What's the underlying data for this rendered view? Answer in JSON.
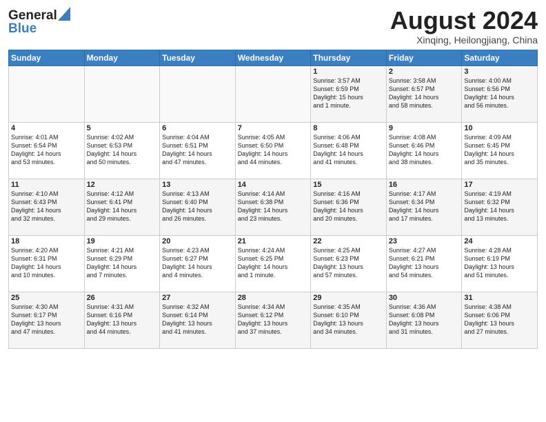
{
  "header": {
    "logo_line1": "General",
    "logo_line2": "Blue",
    "month_year": "August 2024",
    "location": "Xinqing, Heilongjiang, China"
  },
  "days_of_week": [
    "Sunday",
    "Monday",
    "Tuesday",
    "Wednesday",
    "Thursday",
    "Friday",
    "Saturday"
  ],
  "weeks": [
    [
      {
        "day": "",
        "info": ""
      },
      {
        "day": "",
        "info": ""
      },
      {
        "day": "",
        "info": ""
      },
      {
        "day": "",
        "info": ""
      },
      {
        "day": "1",
        "info": "Sunrise: 3:57 AM\nSunset: 6:59 PM\nDaylight: 15 hours\nand 1 minute."
      },
      {
        "day": "2",
        "info": "Sunrise: 3:58 AM\nSunset: 6:57 PM\nDaylight: 14 hours\nand 58 minutes."
      },
      {
        "day": "3",
        "info": "Sunrise: 4:00 AM\nSunset: 6:56 PM\nDaylight: 14 hours\nand 56 minutes."
      }
    ],
    [
      {
        "day": "4",
        "info": "Sunrise: 4:01 AM\nSunset: 6:54 PM\nDaylight: 14 hours\nand 53 minutes."
      },
      {
        "day": "5",
        "info": "Sunrise: 4:02 AM\nSunset: 6:53 PM\nDaylight: 14 hours\nand 50 minutes."
      },
      {
        "day": "6",
        "info": "Sunrise: 4:04 AM\nSunset: 6:51 PM\nDaylight: 14 hours\nand 47 minutes."
      },
      {
        "day": "7",
        "info": "Sunrise: 4:05 AM\nSunset: 6:50 PM\nDaylight: 14 hours\nand 44 minutes."
      },
      {
        "day": "8",
        "info": "Sunrise: 4:06 AM\nSunset: 6:48 PM\nDaylight: 14 hours\nand 41 minutes."
      },
      {
        "day": "9",
        "info": "Sunrise: 4:08 AM\nSunset: 6:46 PM\nDaylight: 14 hours\nand 38 minutes."
      },
      {
        "day": "10",
        "info": "Sunrise: 4:09 AM\nSunset: 6:45 PM\nDaylight: 14 hours\nand 35 minutes."
      }
    ],
    [
      {
        "day": "11",
        "info": "Sunrise: 4:10 AM\nSunset: 6:43 PM\nDaylight: 14 hours\nand 32 minutes."
      },
      {
        "day": "12",
        "info": "Sunrise: 4:12 AM\nSunset: 6:41 PM\nDaylight: 14 hours\nand 29 minutes."
      },
      {
        "day": "13",
        "info": "Sunrise: 4:13 AM\nSunset: 6:40 PM\nDaylight: 14 hours\nand 26 minutes."
      },
      {
        "day": "14",
        "info": "Sunrise: 4:14 AM\nSunset: 6:38 PM\nDaylight: 14 hours\nand 23 minutes."
      },
      {
        "day": "15",
        "info": "Sunrise: 4:16 AM\nSunset: 6:36 PM\nDaylight: 14 hours\nand 20 minutes."
      },
      {
        "day": "16",
        "info": "Sunrise: 4:17 AM\nSunset: 6:34 PM\nDaylight: 14 hours\nand 17 minutes."
      },
      {
        "day": "17",
        "info": "Sunrise: 4:19 AM\nSunset: 6:32 PM\nDaylight: 14 hours\nand 13 minutes."
      }
    ],
    [
      {
        "day": "18",
        "info": "Sunrise: 4:20 AM\nSunset: 6:31 PM\nDaylight: 14 hours\nand 10 minutes."
      },
      {
        "day": "19",
        "info": "Sunrise: 4:21 AM\nSunset: 6:29 PM\nDaylight: 14 hours\nand 7 minutes."
      },
      {
        "day": "20",
        "info": "Sunrise: 4:23 AM\nSunset: 6:27 PM\nDaylight: 14 hours\nand 4 minutes."
      },
      {
        "day": "21",
        "info": "Sunrise: 4:24 AM\nSunset: 6:25 PM\nDaylight: 14 hours\nand 1 minute."
      },
      {
        "day": "22",
        "info": "Sunrise: 4:25 AM\nSunset: 6:23 PM\nDaylight: 13 hours\nand 57 minutes."
      },
      {
        "day": "23",
        "info": "Sunrise: 4:27 AM\nSunset: 6:21 PM\nDaylight: 13 hours\nand 54 minutes."
      },
      {
        "day": "24",
        "info": "Sunrise: 4:28 AM\nSunset: 6:19 PM\nDaylight: 13 hours\nand 51 minutes."
      }
    ],
    [
      {
        "day": "25",
        "info": "Sunrise: 4:30 AM\nSunset: 6:17 PM\nDaylight: 13 hours\nand 47 minutes."
      },
      {
        "day": "26",
        "info": "Sunrise: 4:31 AM\nSunset: 6:16 PM\nDaylight: 13 hours\nand 44 minutes."
      },
      {
        "day": "27",
        "info": "Sunrise: 4:32 AM\nSunset: 6:14 PM\nDaylight: 13 hours\nand 41 minutes."
      },
      {
        "day": "28",
        "info": "Sunrise: 4:34 AM\nSunset: 6:12 PM\nDaylight: 13 hours\nand 37 minutes."
      },
      {
        "day": "29",
        "info": "Sunrise: 4:35 AM\nSunset: 6:10 PM\nDaylight: 13 hours\nand 34 minutes."
      },
      {
        "day": "30",
        "info": "Sunrise: 4:36 AM\nSunset: 6:08 PM\nDaylight: 13 hours\nand 31 minutes."
      },
      {
        "day": "31",
        "info": "Sunrise: 4:38 AM\nSunset: 6:06 PM\nDaylight: 13 hours\nand 27 minutes."
      }
    ]
  ]
}
